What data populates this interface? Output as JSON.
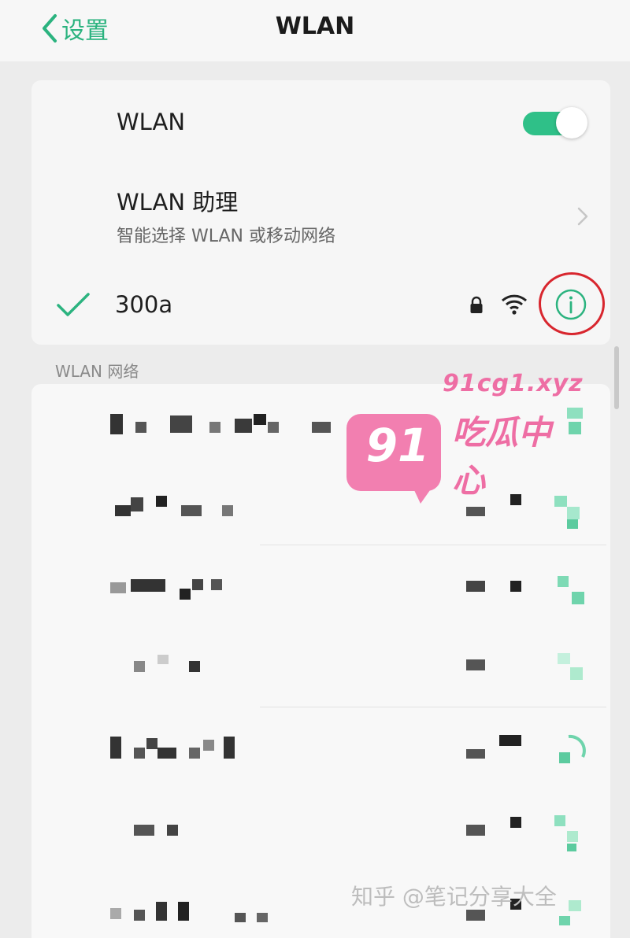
{
  "header": {
    "back_label": "设置",
    "title": "WLAN"
  },
  "wlan": {
    "toggle_label": "WLAN",
    "enabled": true
  },
  "assistant": {
    "title": "WLAN 助理",
    "subtitle": "智能选择 WLAN 或移动网络"
  },
  "connected": {
    "ssid": "300a",
    "secured": true,
    "icons": [
      "check-icon",
      "lock-icon",
      "wifi-icon",
      "info-icon"
    ]
  },
  "networks": {
    "section_label": "WLAN 网络",
    "rows": [
      {
        "name": "",
        "pixelated": true
      },
      {
        "name": "",
        "pixelated": true
      },
      {
        "name": "",
        "pixelated": true
      },
      {
        "name": "",
        "pixelated": true
      },
      {
        "name": "",
        "pixelated": true
      },
      {
        "name": "",
        "pixelated": true
      },
      {
        "name": "",
        "pixelated": true
      }
    ]
  },
  "watermark": {
    "badge": "91",
    "url": "91cg1.xyz",
    "text": "吃瓜中心"
  },
  "credit": "知乎 @笔记分享大全",
  "colors": {
    "accent": "#2bb37f",
    "highlight_ring": "#d8262e",
    "watermark": "#f27fb0"
  }
}
